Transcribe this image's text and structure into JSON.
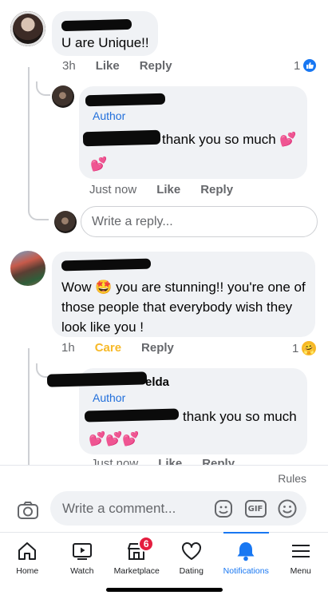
{
  "comments": [
    {
      "text": "U are Unique!!",
      "time": "3h",
      "like": "Like",
      "reply": "Reply",
      "reaction_count": "1",
      "replies": [
        {
          "author_badge": "Author",
          "text": "thank you so much 💕",
          "emoji_line": "💕",
          "time": "Just now",
          "like": "Like",
          "reply": "Reply"
        }
      ]
    },
    {
      "text": "Wow 🤩 you are stunning!! you're one of those people that everybody wish they look like you !",
      "time": "1h",
      "care": "Care",
      "reply": "Reply",
      "reaction_count": "1",
      "reaction_emoji": "🤗",
      "replies": [
        {
          "name_visible": "elda",
          "author_badge": "Author",
          "text": "thank you so much",
          "emoji_line": "💕💕💕",
          "time": "Just now",
          "like": "Like",
          "reply": "Reply"
        }
      ]
    }
  ],
  "reply_input": {
    "placeholder": "Write a reply..."
  },
  "rules_link": "Rules",
  "composer": {
    "placeholder": "Write a comment...",
    "gif_label": "GIF"
  },
  "tabs": [
    {
      "label": "Home",
      "icon": "home-icon"
    },
    {
      "label": "Watch",
      "icon": "watch-icon"
    },
    {
      "label": "Marketplace",
      "icon": "marketplace-icon",
      "badge": "6"
    },
    {
      "label": "Dating",
      "icon": "heart-icon"
    },
    {
      "label": "Notifications",
      "icon": "bell-icon",
      "active": true
    },
    {
      "label": "Menu",
      "icon": "menu-icon"
    }
  ],
  "colors": {
    "accent": "#1877f2",
    "care": "#f7b928",
    "bubble": "#f0f2f5",
    "badge": "#e41e3f"
  }
}
